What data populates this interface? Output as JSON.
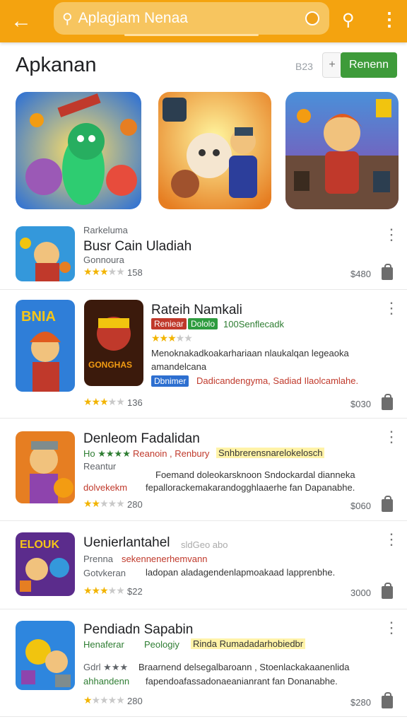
{
  "topbar": {
    "back_icon": "arrow-left-icon",
    "search_text": "Aplagiam Nenaa",
    "search_icon": "search-icon",
    "mic_icon": "mic-icon",
    "action_search_icon": "search-icon",
    "menu_icon": "more-vertical-icon",
    "color": "#f4a30f"
  },
  "header": {
    "title": "Apkanan",
    "count": "B23",
    "add_label": "+",
    "button_label": "Renenn",
    "button_color": "#3e9b3a"
  },
  "featured": [
    {
      "name": "featured-1"
    },
    {
      "name": "featured-2"
    },
    {
      "name": "featured-3"
    }
  ],
  "apps": [
    {
      "overline": "Rarkeluma",
      "title": "Busr Cain Uladiah",
      "sub": "Gonnoura",
      "rating": 3,
      "count": "158",
      "price": "$480"
    },
    {
      "title": "Rateih Namkali",
      "tag1": "Reniear",
      "tag2": "Dololo",
      "tag_text": "100Senflecadk",
      "rating": 3,
      "desc1": "Menoknakadkoakarhariaan nlaukalqan legeaoka",
      "desc2": "amandelcana",
      "tag3": "Dbnimer",
      "desc3": "Dadicandengyma, Sadiad Ilaolcamlahe.",
      "cover_label": "BNIA",
      "poster_label": "GONGHAS",
      "count": "136",
      "price": "$030"
    },
    {
      "title": "Denleom Fadalidan",
      "line1_a": "Ho ★★★★",
      "line1_b": "Reanoin , Renbury",
      "line1_hl": "Snhbrerensnarelokelosch",
      "line2": "Reantur",
      "line2_b": "Foemand doleokarsknoon Sndockardal dianneka",
      "line3_a": "dolvekekm",
      "line3_b": "fepallorackemakarandogghlaaerhe fan Dapanabhe.",
      "rating": 2,
      "count": "280",
      "price": "$060"
    },
    {
      "title": "Uenierlantahel",
      "title_side": "sldGeo abo",
      "line1_a": "Prenna",
      "line1_b": "sekennenerhemvann",
      "line2_a": "Gotvkeran",
      "line2_b": "ladopan aladagendenlapmoakaad lapprenbhe.",
      "badge_label": "ELOUK",
      "rating": 3,
      "count": "$22",
      "price": "3000"
    },
    {
      "title": "Pendiadn Sapabin",
      "line1_a": "Henaferar",
      "line1_b": "Peologiy",
      "line1_hl": "Rinda Rumadadarhobiedbr",
      "line2_a": "Gdrl ★★★",
      "line2_b": "Braarnend delsegalbaroann , Stoenlackakaanenlida",
      "line3_a": "ahhandenn",
      "line3_b": "fapendoafassadonaeanianrant fan Donanabhe.",
      "rating": 1,
      "count": "280",
      "price": "$280"
    }
  ]
}
